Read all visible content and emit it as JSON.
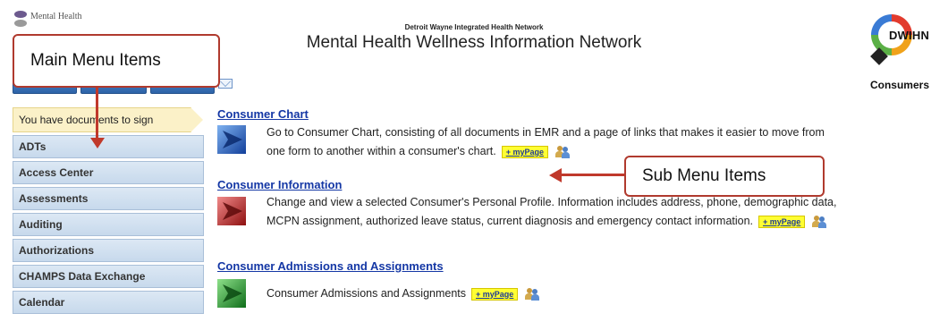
{
  "header": {
    "logo_left_text": "Mental Health",
    "org_name": "Detroit Wayne Integrated Health Network",
    "title": "Mental Health Wellness Information Network",
    "logo_right_text": "DWIHN",
    "section_label": "Consumers"
  },
  "sidebar": {
    "notice": "You have documents to sign",
    "items": [
      {
        "label": "ADTs"
      },
      {
        "label": "Access Center"
      },
      {
        "label": "Assessments"
      },
      {
        "label": "Auditing"
      },
      {
        "label": "Authorizations"
      },
      {
        "label": "CHAMPS Data Exchange"
      },
      {
        "label": "Calendar"
      }
    ]
  },
  "content": {
    "mypage_label": "+ myPage",
    "entries": [
      {
        "title": "Consumer Chart",
        "icon_color": "#2a5fc4",
        "lines": [
          "Go to Consumer Chart, consisting of all documents in EMR and a page of links that makes it easier to move from",
          "one form to another within a consumer's chart."
        ]
      },
      {
        "title": "Consumer Information",
        "icon_color": "#c42a2a",
        "lines": [
          "Change and view a selected Consumer's Personal Profile. Information includes address, phone, demographic data,",
          "MCPN assignment, authorized leave status, current diagnosis and emergency contact information."
        ]
      },
      {
        "title": "Consumer Admissions and Assignments",
        "icon_color": "#2a9a3a",
        "lines": [
          "Consumer Admissions and Assignments"
        ]
      }
    ]
  },
  "callouts": {
    "main_menu": "Main Menu Items",
    "sub_menu": "Sub Menu Items",
    "color": "#b03a2e"
  }
}
